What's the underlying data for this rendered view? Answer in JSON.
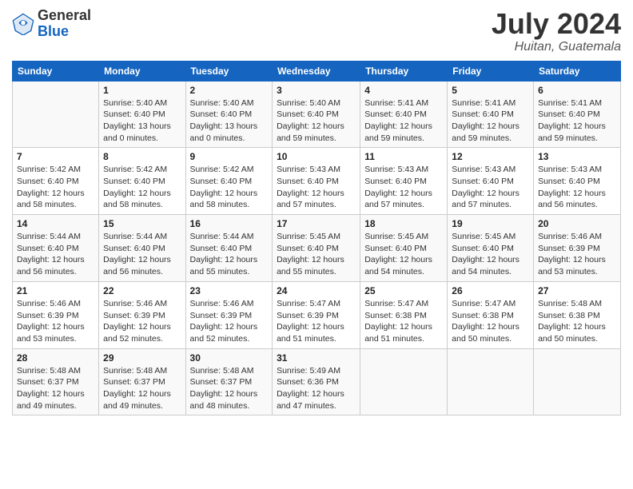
{
  "header": {
    "logo_general": "General",
    "logo_blue": "Blue",
    "month_year": "July 2024",
    "location": "Huitan, Guatemala"
  },
  "days_of_week": [
    "Sunday",
    "Monday",
    "Tuesday",
    "Wednesday",
    "Thursday",
    "Friday",
    "Saturday"
  ],
  "weeks": [
    [
      {
        "day": "",
        "sunrise": "",
        "sunset": "",
        "daylight": ""
      },
      {
        "day": "1",
        "sunrise": "Sunrise: 5:40 AM",
        "sunset": "Sunset: 6:40 PM",
        "daylight": "Daylight: 13 hours and 0 minutes."
      },
      {
        "day": "2",
        "sunrise": "Sunrise: 5:40 AM",
        "sunset": "Sunset: 6:40 PM",
        "daylight": "Daylight: 13 hours and 0 minutes."
      },
      {
        "day": "3",
        "sunrise": "Sunrise: 5:40 AM",
        "sunset": "Sunset: 6:40 PM",
        "daylight": "Daylight: 12 hours and 59 minutes."
      },
      {
        "day": "4",
        "sunrise": "Sunrise: 5:41 AM",
        "sunset": "Sunset: 6:40 PM",
        "daylight": "Daylight: 12 hours and 59 minutes."
      },
      {
        "day": "5",
        "sunrise": "Sunrise: 5:41 AM",
        "sunset": "Sunset: 6:40 PM",
        "daylight": "Daylight: 12 hours and 59 minutes."
      },
      {
        "day": "6",
        "sunrise": "Sunrise: 5:41 AM",
        "sunset": "Sunset: 6:40 PM",
        "daylight": "Daylight: 12 hours and 59 minutes."
      }
    ],
    [
      {
        "day": "7",
        "sunrise": "Sunrise: 5:42 AM",
        "sunset": "Sunset: 6:40 PM",
        "daylight": "Daylight: 12 hours and 58 minutes."
      },
      {
        "day": "8",
        "sunrise": "Sunrise: 5:42 AM",
        "sunset": "Sunset: 6:40 PM",
        "daylight": "Daylight: 12 hours and 58 minutes."
      },
      {
        "day": "9",
        "sunrise": "Sunrise: 5:42 AM",
        "sunset": "Sunset: 6:40 PM",
        "daylight": "Daylight: 12 hours and 58 minutes."
      },
      {
        "day": "10",
        "sunrise": "Sunrise: 5:43 AM",
        "sunset": "Sunset: 6:40 PM",
        "daylight": "Daylight: 12 hours and 57 minutes."
      },
      {
        "day": "11",
        "sunrise": "Sunrise: 5:43 AM",
        "sunset": "Sunset: 6:40 PM",
        "daylight": "Daylight: 12 hours and 57 minutes."
      },
      {
        "day": "12",
        "sunrise": "Sunrise: 5:43 AM",
        "sunset": "Sunset: 6:40 PM",
        "daylight": "Daylight: 12 hours and 57 minutes."
      },
      {
        "day": "13",
        "sunrise": "Sunrise: 5:43 AM",
        "sunset": "Sunset: 6:40 PM",
        "daylight": "Daylight: 12 hours and 56 minutes."
      }
    ],
    [
      {
        "day": "14",
        "sunrise": "Sunrise: 5:44 AM",
        "sunset": "Sunset: 6:40 PM",
        "daylight": "Daylight: 12 hours and 56 minutes."
      },
      {
        "day": "15",
        "sunrise": "Sunrise: 5:44 AM",
        "sunset": "Sunset: 6:40 PM",
        "daylight": "Daylight: 12 hours and 56 minutes."
      },
      {
        "day": "16",
        "sunrise": "Sunrise: 5:44 AM",
        "sunset": "Sunset: 6:40 PM",
        "daylight": "Daylight: 12 hours and 55 minutes."
      },
      {
        "day": "17",
        "sunrise": "Sunrise: 5:45 AM",
        "sunset": "Sunset: 6:40 PM",
        "daylight": "Daylight: 12 hours and 55 minutes."
      },
      {
        "day": "18",
        "sunrise": "Sunrise: 5:45 AM",
        "sunset": "Sunset: 6:40 PM",
        "daylight": "Daylight: 12 hours and 54 minutes."
      },
      {
        "day": "19",
        "sunrise": "Sunrise: 5:45 AM",
        "sunset": "Sunset: 6:40 PM",
        "daylight": "Daylight: 12 hours and 54 minutes."
      },
      {
        "day": "20",
        "sunrise": "Sunrise: 5:46 AM",
        "sunset": "Sunset: 6:39 PM",
        "daylight": "Daylight: 12 hours and 53 minutes."
      }
    ],
    [
      {
        "day": "21",
        "sunrise": "Sunrise: 5:46 AM",
        "sunset": "Sunset: 6:39 PM",
        "daylight": "Daylight: 12 hours and 53 minutes."
      },
      {
        "day": "22",
        "sunrise": "Sunrise: 5:46 AM",
        "sunset": "Sunset: 6:39 PM",
        "daylight": "Daylight: 12 hours and 52 minutes."
      },
      {
        "day": "23",
        "sunrise": "Sunrise: 5:46 AM",
        "sunset": "Sunset: 6:39 PM",
        "daylight": "Daylight: 12 hours and 52 minutes."
      },
      {
        "day": "24",
        "sunrise": "Sunrise: 5:47 AM",
        "sunset": "Sunset: 6:39 PM",
        "daylight": "Daylight: 12 hours and 51 minutes."
      },
      {
        "day": "25",
        "sunrise": "Sunrise: 5:47 AM",
        "sunset": "Sunset: 6:38 PM",
        "daylight": "Daylight: 12 hours and 51 minutes."
      },
      {
        "day": "26",
        "sunrise": "Sunrise: 5:47 AM",
        "sunset": "Sunset: 6:38 PM",
        "daylight": "Daylight: 12 hours and 50 minutes."
      },
      {
        "day": "27",
        "sunrise": "Sunrise: 5:48 AM",
        "sunset": "Sunset: 6:38 PM",
        "daylight": "Daylight: 12 hours and 50 minutes."
      }
    ],
    [
      {
        "day": "28",
        "sunrise": "Sunrise: 5:48 AM",
        "sunset": "Sunset: 6:37 PM",
        "daylight": "Daylight: 12 hours and 49 minutes."
      },
      {
        "day": "29",
        "sunrise": "Sunrise: 5:48 AM",
        "sunset": "Sunset: 6:37 PM",
        "daylight": "Daylight: 12 hours and 49 minutes."
      },
      {
        "day": "30",
        "sunrise": "Sunrise: 5:48 AM",
        "sunset": "Sunset: 6:37 PM",
        "daylight": "Daylight: 12 hours and 48 minutes."
      },
      {
        "day": "31",
        "sunrise": "Sunrise: 5:49 AM",
        "sunset": "Sunset: 6:36 PM",
        "daylight": "Daylight: 12 hours and 47 minutes."
      },
      {
        "day": "",
        "sunrise": "",
        "sunset": "",
        "daylight": ""
      },
      {
        "day": "",
        "sunrise": "",
        "sunset": "",
        "daylight": ""
      },
      {
        "day": "",
        "sunrise": "",
        "sunset": "",
        "daylight": ""
      }
    ]
  ]
}
